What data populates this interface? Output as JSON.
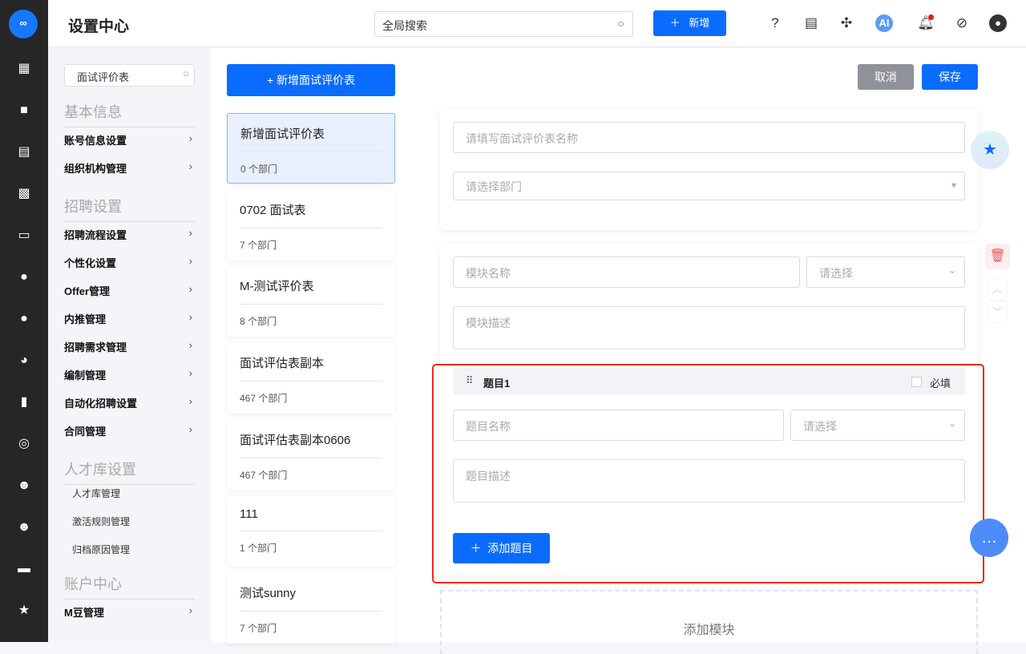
{
  "header": {
    "title": "设置中心",
    "search_placeholder": "全局搜索",
    "new_label": "新增",
    "ai_label": "AI"
  },
  "sidebar": {
    "search_value": "面试评价表",
    "sections": [
      {
        "title": "基本信息",
        "items": [
          "账号信息设置",
          "组织机构管理"
        ]
      },
      {
        "title": "招聘设置",
        "items": [
          "招聘流程设置",
          "个性化设置",
          "Offer管理",
          "内推管理",
          "招聘需求管理",
          "编制管理",
          "自动化招聘设置",
          "合同管理"
        ]
      },
      {
        "title": "人才库设置",
        "subitems": [
          "人才库管理",
          "激活规则管理",
          "归档原因管理"
        ]
      },
      {
        "title": "账户中心",
        "items": [
          "M豆管理"
        ]
      }
    ]
  },
  "list": {
    "add_label": "+ 新增面试评价表",
    "cards": [
      {
        "name": "新增面试评价表",
        "depts": "0 个部门"
      },
      {
        "name": "0702 面试表",
        "depts": "7 个部门"
      },
      {
        "name": "M-测试评价表",
        "depts": "8 个部门"
      },
      {
        "name": "面试评估表副本",
        "depts": "467 个部门"
      },
      {
        "name": "面试评估表副本0606",
        "depts": "467 个部门"
      },
      {
        "name": "111",
        "depts": "1 个部门"
      },
      {
        "name": "测试sunny",
        "depts": "7 个部门"
      }
    ]
  },
  "form": {
    "cancel": "取消",
    "save": "保存",
    "name_placeholder": "请填写面试评价表名称",
    "dept_placeholder": "请选择部门",
    "module_name_placeholder": "模块名称",
    "select_placeholder": "请选择",
    "module_desc_placeholder": "模块描述",
    "question_title": "题目1",
    "required_label": "必填",
    "question_name_placeholder": "题目名称",
    "question_desc_placeholder": "题目描述",
    "add_question": "添加题目",
    "add_module": "添加模块"
  }
}
